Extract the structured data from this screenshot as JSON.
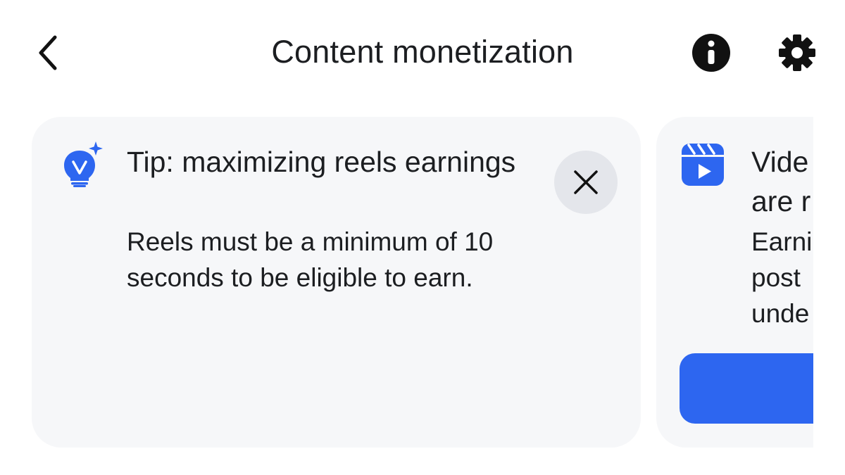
{
  "header": {
    "title": "Content monetization",
    "back_icon": "chevron-left-icon",
    "info_icon": "info-icon",
    "settings_icon": "gear-icon"
  },
  "cards": [
    {
      "icon": "lightbulb-sparkle-icon",
      "title": "Tip: maximizing reels earnings",
      "body": "Reels must be a minimum of 10 seconds to be eligible to earn.",
      "close_icon": "close-icon"
    },
    {
      "icon": "reels-icon",
      "title": "Vide\nare r",
      "body": "Earni\npost\nunde"
    }
  ],
  "colors": {
    "accent": "#2d66f0",
    "card_bg": "#f6f7f9",
    "close_bg": "#e4e6eb",
    "text": "#1c1e21"
  }
}
